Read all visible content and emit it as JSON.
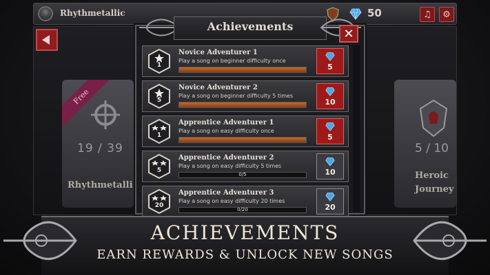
{
  "topbar": {
    "username": "Rhythmetallic",
    "gem_count": "50",
    "rank_icon": "shield-rank-icon",
    "gem_icon": "diamond-gem-icon",
    "music_icon": "music-note-icon",
    "settings_icon": "gear-icon",
    "music_glyph": "♫",
    "settings_glyph": "⚙"
  },
  "modal": {
    "title": "Achievements",
    "close_glyph": "✕",
    "achievements": [
      {
        "title": "Novice Adventurer 1",
        "description": "Play a song on beginner difficulty once",
        "badge_stars": 1,
        "badge_count": "1",
        "progress": 1.0,
        "progress_text": "",
        "reward": "5",
        "claimed": true
      },
      {
        "title": "Novice Adventurer 2",
        "description": "Play a song on beginner difficulty 5 times",
        "badge_stars": 1,
        "badge_count": "5",
        "progress": 1.0,
        "progress_text": "",
        "reward": "10",
        "claimed": true
      },
      {
        "title": "Apprentice Adventurer 1",
        "description": "Play a song on easy difficulty once",
        "badge_stars": 2,
        "badge_count": "1",
        "progress": 1.0,
        "progress_text": "",
        "reward": "5",
        "claimed": true
      },
      {
        "title": "Apprentice Adventurer 2",
        "description": "Play a song on easy difficulty 5 times",
        "badge_stars": 2,
        "badge_count": "5",
        "progress": 0.0,
        "progress_text": "0/5",
        "reward": "10",
        "claimed": false
      },
      {
        "title": "Apprentice Adventurer 3",
        "description": "Play a song on easy difficulty 20 times",
        "badge_stars": 2,
        "badge_count": "20",
        "progress": 0.0,
        "progress_text": "0/20",
        "reward": "20",
        "claimed": false
      }
    ]
  },
  "cards": {
    "left": {
      "ribbon": "Free",
      "progress": "19 / 39",
      "name": "Rhythmetalli"
    },
    "right": {
      "progress": "5 / 10",
      "name_line1": "Heroic",
      "name_line2": "Journey"
    }
  },
  "banner": {
    "title": "ACHIEVEMENTS",
    "subtitle": "EARN REWARDS & UNLOCK NEW SONGS"
  },
  "colors": {
    "accent_red": "#9e1a1a",
    "progress_orange": "#c46a2a",
    "locked_grey": "#3a3a40"
  }
}
